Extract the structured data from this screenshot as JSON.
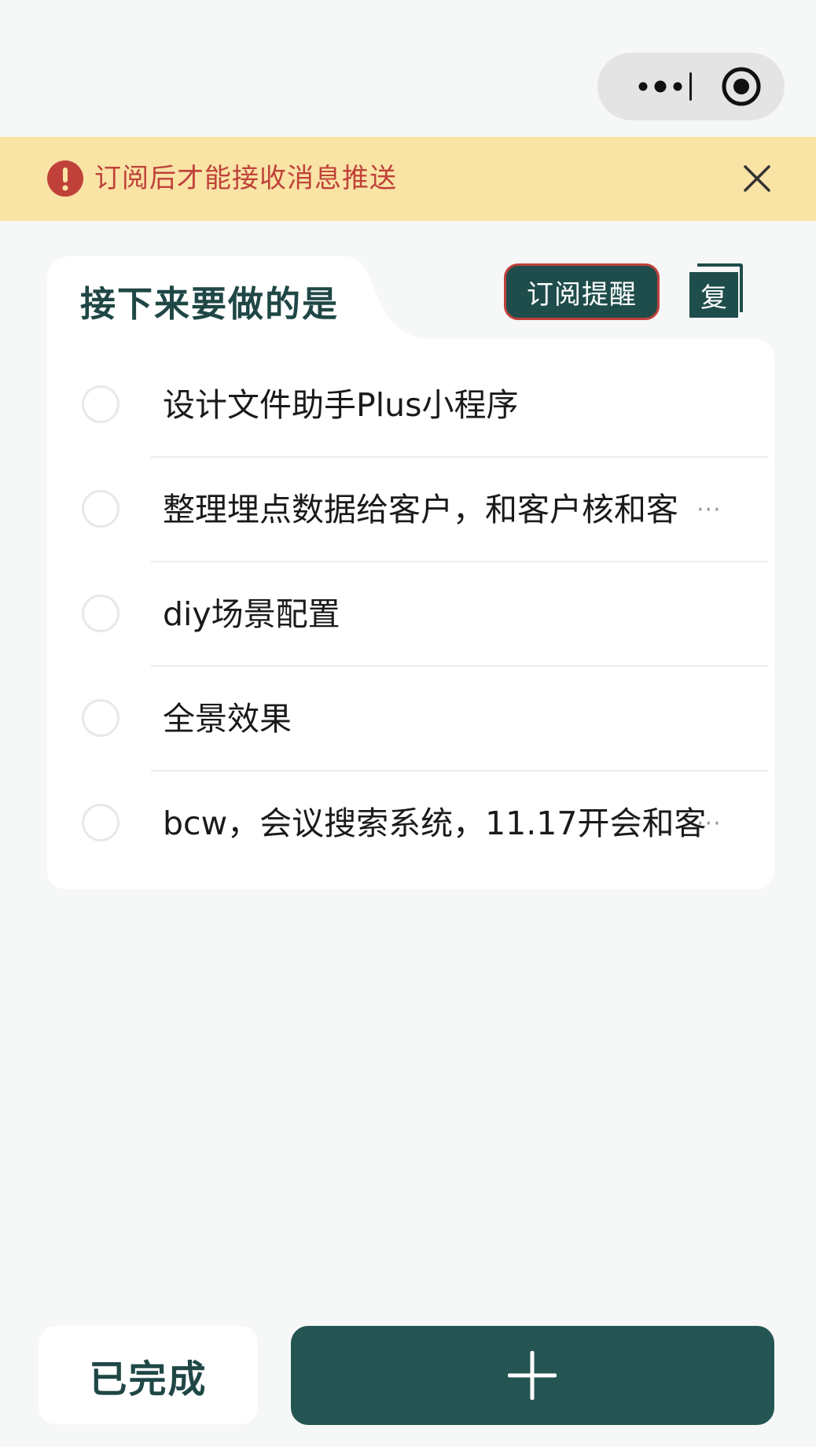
{
  "capsule": {
    "more_icon": "more-dots-icon",
    "close_icon": "target-close-icon"
  },
  "notice": {
    "icon": "warning-circle-icon",
    "text": "订阅后才能接收消息推送",
    "close_icon": "close-x-icon",
    "bg_color": "#f9e3a5",
    "text_color": "#c0413a"
  },
  "card": {
    "title": "接下来要做的是",
    "subscribe_label": "订阅提醒",
    "copy_label": "复",
    "copy_icon": "copy-icon"
  },
  "tasks": [
    {
      "text": "设计文件助手Plus小程序",
      "truncated": false
    },
    {
      "text": "整理埋点数据给客户，和客户核和客",
      "truncated": true,
      "ellipsis": "···"
    },
    {
      "text": "diy场景配置",
      "truncated": false
    },
    {
      "text": "全景效果",
      "truncated": false
    },
    {
      "text": "bcw，会议搜索系统，11.17开会和客",
      "truncated": true,
      "ellipsis": "···"
    }
  ],
  "bottom": {
    "done_label": "已完成",
    "add_icon": "plus-icon"
  },
  "colors": {
    "accent": "#245552",
    "title": "#1f4745",
    "warning": "#c0413a",
    "background": "#f6f7f7"
  }
}
